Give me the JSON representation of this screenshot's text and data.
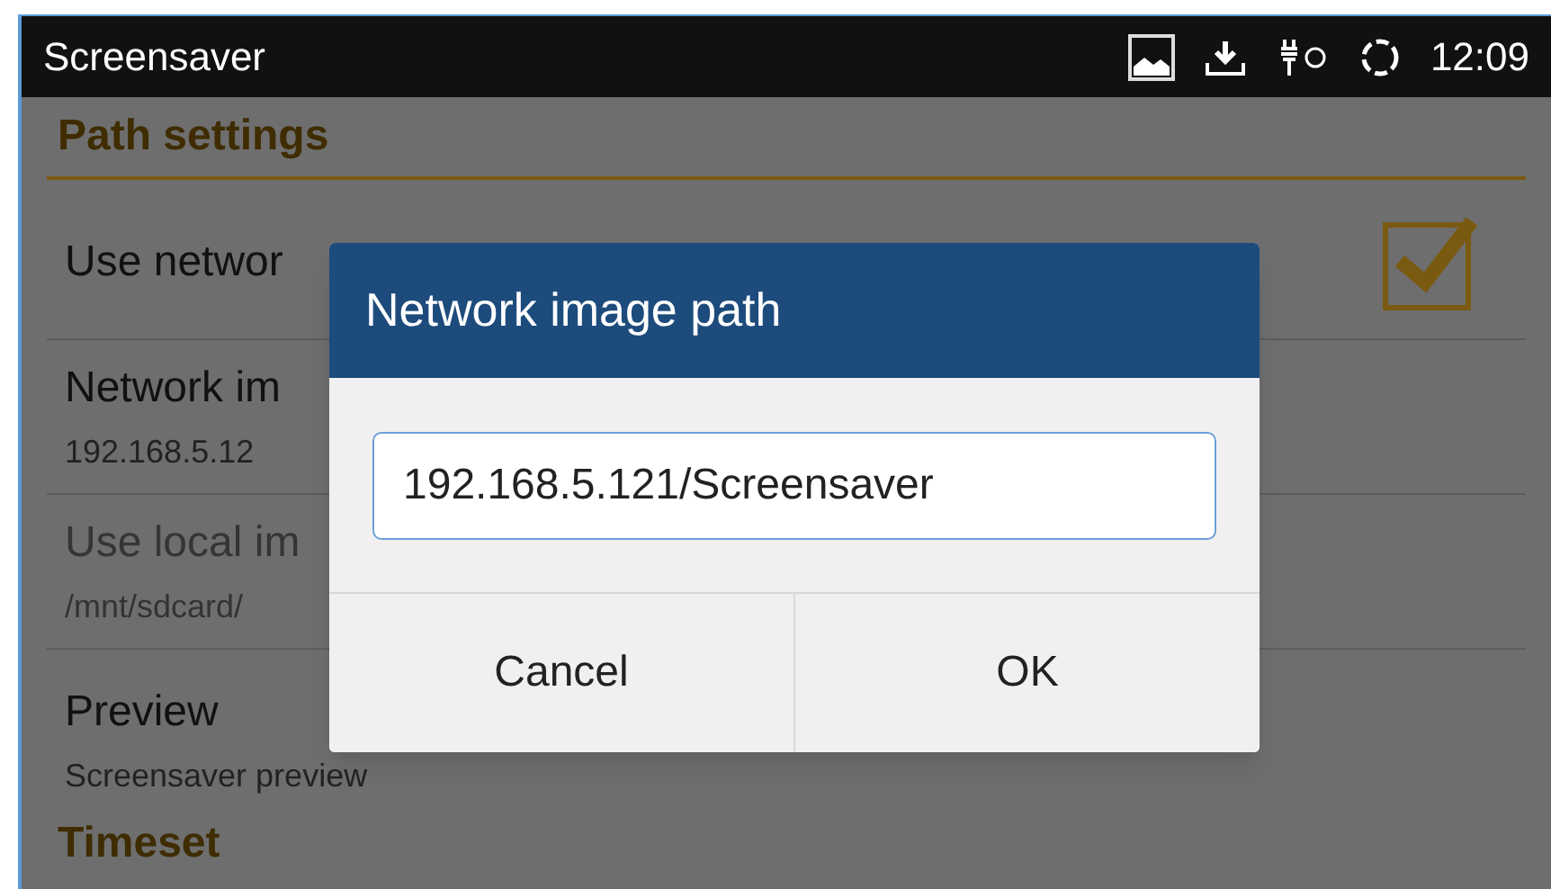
{
  "status_bar": {
    "title": "Screensaver",
    "time": "12:09"
  },
  "sections": [
    {
      "header": "Path settings",
      "items": [
        {
          "kind": "checkbox",
          "title": "Use networ",
          "checked": true,
          "disabled": false
        },
        {
          "kind": "text",
          "title": "Network im",
          "summary": "192.168.5.12",
          "disabled": false
        },
        {
          "kind": "text",
          "title": "Use local im",
          "summary": "/mnt/sdcard/",
          "disabled": true
        },
        {
          "kind": "text",
          "title": "Preview",
          "summary": "Screensaver preview",
          "disabled": false
        }
      ]
    },
    {
      "header": "Timeset"
    }
  ],
  "dialog": {
    "title": "Network image path",
    "value": "192.168.5.121/Screensaver",
    "buttons": [
      "Cancel",
      "OK"
    ]
  }
}
